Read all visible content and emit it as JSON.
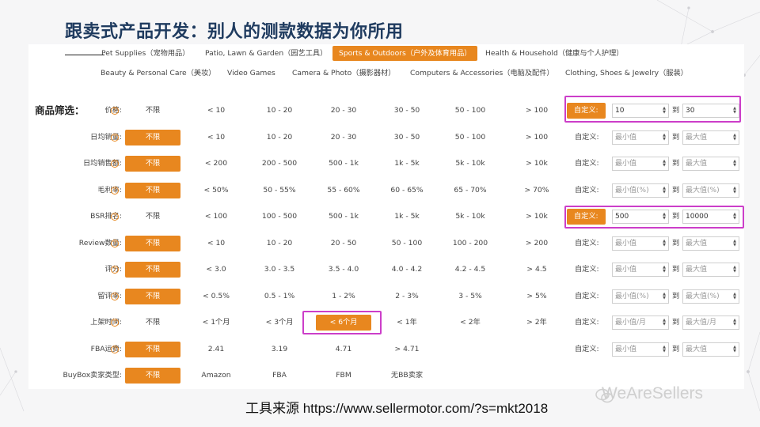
{
  "slide": {
    "title": "跟卖式产品开发：别人的测款数据为你所用",
    "source": "工具来源 https://www.sellermotor.com/?s=mkt2018",
    "watermark": "WeAreSellers"
  },
  "categories": {
    "row1": [
      "Pet Supplies（宠物用品）",
      "Patio, Lawn & Garden（园艺工具）",
      "Sports & Outdoors（户外及体育用品）",
      "Health & Household（健康与个人护理）"
    ],
    "row2": [
      "Beauty & Personal Care（美妆）",
      "Video Games",
      "Camera & Photo（摄影器材）",
      "Computers & Accessories（电脑及配件）",
      "Clothing, Shoes & Jewelry（服装）"
    ],
    "active": "Sports & Outdoors（户外及体育用品）"
  },
  "filters": {
    "section_label": "商品筛选：",
    "custom_label": "自定义:",
    "to_label": "到",
    "help_glyph": "?",
    "rows": [
      {
        "label": "价格:",
        "options": [
          "不限",
          "< 10",
          "10 - 20",
          "20 - 30",
          "30 - 50",
          "50 - 100",
          "> 100"
        ],
        "selected": null,
        "custom_active": true,
        "min": "10",
        "max": "30",
        "min_ph": "",
        "max_ph": ""
      },
      {
        "label": "日均销量:",
        "options": [
          "不限",
          "< 10",
          "10 - 20",
          "20 - 30",
          "30 - 50",
          "50 - 100",
          "> 100"
        ],
        "selected": 0,
        "custom_active": false,
        "min": "",
        "max": "",
        "min_ph": "最小值",
        "max_ph": "最大值"
      },
      {
        "label": "日均销售额:",
        "options": [
          "不限",
          "< 200",
          "200 - 500",
          "500 - 1k",
          "1k - 5k",
          "5k - 10k",
          "> 10k"
        ],
        "selected": 0,
        "custom_active": false,
        "min": "",
        "max": "",
        "min_ph": "最小值",
        "max_ph": "最大值"
      },
      {
        "label": "毛利率:",
        "options": [
          "不限",
          "< 50%",
          "50 - 55%",
          "55 - 60%",
          "60 - 65%",
          "65 - 70%",
          "> 70%"
        ],
        "selected": 0,
        "custom_active": false,
        "min": "",
        "max": "",
        "min_ph": "最小值(%)",
        "max_ph": "最大值(%)"
      },
      {
        "label": "BSR排名:",
        "options": [
          "不限",
          "< 100",
          "100 - 500",
          "500 - 1k",
          "1k - 5k",
          "5k - 10k",
          "> 10k"
        ],
        "selected": null,
        "custom_active": true,
        "min": "500",
        "max": "10000",
        "min_ph": "",
        "max_ph": ""
      },
      {
        "label": "Review数量:",
        "options": [
          "不限",
          "< 10",
          "10 - 20",
          "20 - 50",
          "50 - 100",
          "100 - 200",
          "> 200"
        ],
        "selected": 0,
        "custom_active": false,
        "min": "",
        "max": "",
        "min_ph": "最小值",
        "max_ph": "最大值"
      },
      {
        "label": "评分:",
        "options": [
          "不限",
          "< 3.0",
          "3.0 - 3.5",
          "3.5 - 4.0",
          "4.0 - 4.2",
          "4.2 - 4.5",
          "> 4.5"
        ],
        "selected": 0,
        "custom_active": false,
        "min": "",
        "max": "",
        "min_ph": "最小值",
        "max_ph": "最大值"
      },
      {
        "label": "留评率:",
        "options": [
          "不限",
          "< 0.5%",
          "0.5 - 1%",
          "1 - 2%",
          "2 - 3%",
          "3 - 5%",
          "> 5%"
        ],
        "selected": 0,
        "custom_active": false,
        "min": "",
        "max": "",
        "min_ph": "最小值(%)",
        "max_ph": "最大值(%)"
      },
      {
        "label": "上架时间:",
        "options": [
          "不限",
          "< 1个月",
          "< 3个月",
          "< 6个月",
          "< 1年",
          "< 2年",
          "> 2年"
        ],
        "selected": 3,
        "custom_active": false,
        "min": "",
        "max": "",
        "min_ph": "最小值/月",
        "max_ph": "最大值/月"
      },
      {
        "label": "FBA运费:",
        "options": [
          "不限",
          "2.41",
          "3.19",
          "4.71",
          "> 4.71"
        ],
        "selected": 0,
        "custom_active": false,
        "min": "",
        "max": "",
        "min_ph": "最小值",
        "max_ph": "最大值"
      },
      {
        "label": "BuyBox卖家类型:",
        "options": [
          "不限",
          "Amazon",
          "FBA",
          "FBM",
          "无BB卖家"
        ],
        "selected": 0,
        "custom": false
      }
    ]
  },
  "colors": {
    "accent": "#e8871f",
    "highlight": "#cc3ec9",
    "title": "#1f3b5f"
  }
}
